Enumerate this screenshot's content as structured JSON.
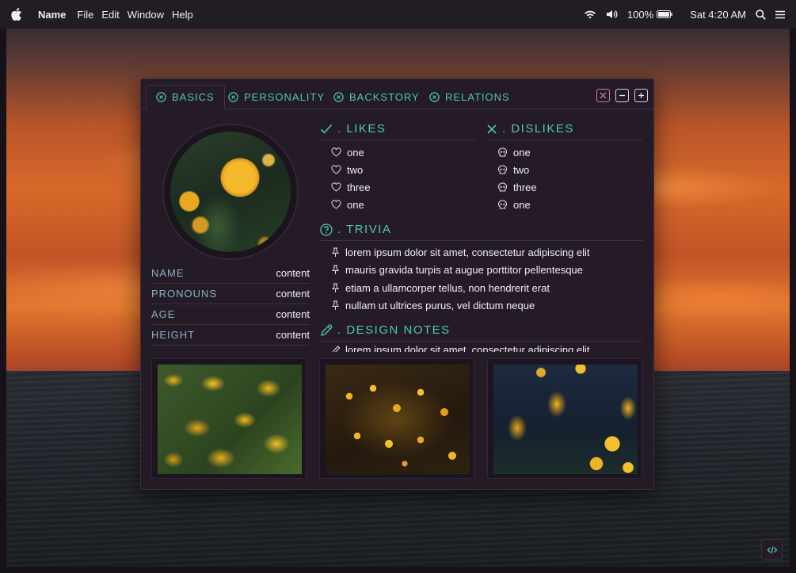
{
  "menubar": {
    "app_name": "Name",
    "menus": [
      "File",
      "Edit",
      "Window",
      "Help"
    ],
    "battery": "100%",
    "clock": "Sat 4:20 AM"
  },
  "tabs": [
    {
      "label": "BASICS",
      "active": true
    },
    {
      "label": "PERSONALITY",
      "active": false
    },
    {
      "label": "BACKSTORY",
      "active": false
    },
    {
      "label": "RELATIONS",
      "active": false
    }
  ],
  "stats": [
    {
      "key": "NAME",
      "value": "content"
    },
    {
      "key": "PRONOUNS",
      "value": "content"
    },
    {
      "key": "AGE",
      "value": "content"
    },
    {
      "key": "HEIGHT",
      "value": "content"
    }
  ],
  "likes": {
    "title": ". LIKES",
    "items": [
      "one",
      "two",
      "three",
      "one"
    ]
  },
  "dislikes": {
    "title": ". DISLIKES",
    "items": [
      "one",
      "two",
      "three",
      "one"
    ]
  },
  "trivia": {
    "title": ". TRIVIA",
    "items": [
      "lorem ipsum dolor sit amet, consectetur adipiscing elit",
      "mauris gravida turpis at augue porttitor pellentesque",
      "etiam a ullamcorper tellus, non hendrerit erat",
      "nullam ut ultrices purus, vel dictum neque"
    ]
  },
  "design_notes": {
    "title": ". DESIGN NOTES",
    "items": [
      "lorem ipsum dolor sit amet, consectetur adipiscing elit"
    ]
  },
  "colors": {
    "accent": "#4ec9b0",
    "label": "#8ab1c6",
    "window_bg": "#241b27",
    "close_border": "#d17a96"
  },
  "icons": {
    "likes": "check-icon",
    "like_item": "heart-icon",
    "dislikes": "x-icon",
    "dislike_item": "skull-icon",
    "trivia": "question-circle-icon",
    "trivia_item": "pin-icon",
    "design_notes": "pencil-icon"
  }
}
